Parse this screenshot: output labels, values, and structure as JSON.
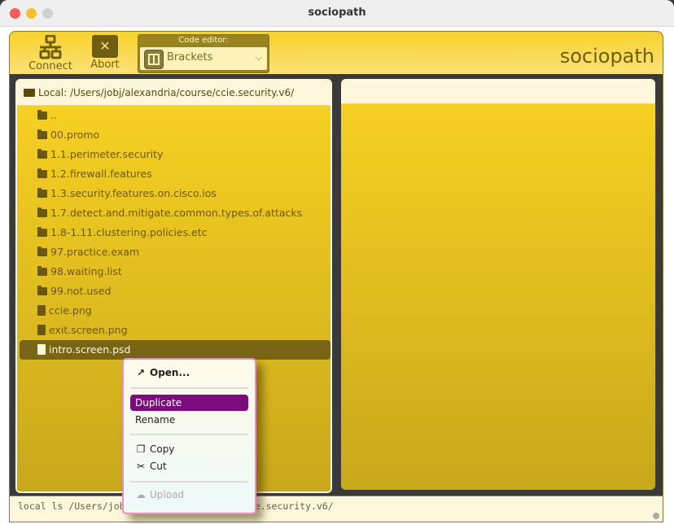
{
  "window": {
    "title": "sociopath"
  },
  "toolbar": {
    "connect_label": "Connect",
    "abort_label": "Abort",
    "editor_label": "Code editor:",
    "editor_value": "Brackets",
    "brand": "sociopath"
  },
  "left_pane": {
    "path": "Local: /Users/jobj/alexandria/course/ccie.security.v6/",
    "items": [
      {
        "name": "..",
        "type": "folder"
      },
      {
        "name": "00.promo",
        "type": "folder"
      },
      {
        "name": "1.1.perimeter.security",
        "type": "folder"
      },
      {
        "name": "1.2.firewall.features",
        "type": "folder"
      },
      {
        "name": "1.3.security.features.on.cisco.ios",
        "type": "folder"
      },
      {
        "name": "1.7.detect.and.mitigate.common.types.of.attacks",
        "type": "folder"
      },
      {
        "name": "1.8-1.11.clustering.policies.etc",
        "type": "folder"
      },
      {
        "name": "97.practice.exam",
        "type": "folder"
      },
      {
        "name": "98.waiting.list",
        "type": "folder"
      },
      {
        "name": "99.not.used",
        "type": "folder"
      },
      {
        "name": "ccie.png",
        "type": "file"
      },
      {
        "name": "exit.screen.png",
        "type": "file"
      },
      {
        "name": "intro.screen.psd",
        "type": "file",
        "selected": true
      }
    ]
  },
  "context_menu": {
    "open": "Open...",
    "duplicate": "Duplicate",
    "rename": "Rename",
    "copy": "Copy",
    "cut": "Cut",
    "upload": "Upload"
  },
  "console": {
    "text": "local ls /Users/jobj/alexandria/course/ccie.security.v6/"
  }
}
